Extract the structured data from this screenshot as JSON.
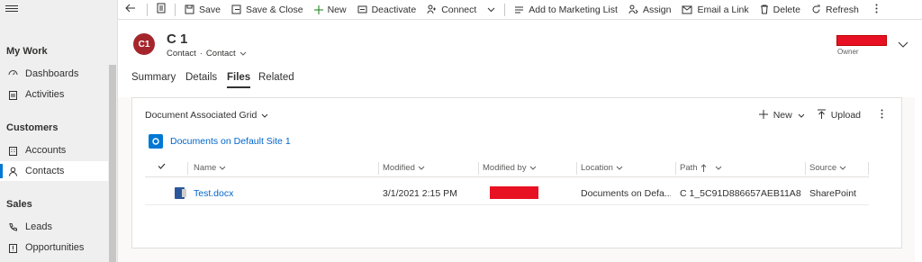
{
  "sidebar": {
    "sections": [
      {
        "label": "My Work"
      },
      {
        "label": "Customers"
      },
      {
        "label": "Sales"
      }
    ],
    "items": [
      {
        "label": "Dashboards",
        "icon": "dashboard-icon"
      },
      {
        "label": "Activities",
        "icon": "clipboard-icon"
      },
      {
        "label": "Accounts",
        "icon": "building-icon"
      },
      {
        "label": "Contacts",
        "icon": "person-icon"
      },
      {
        "label": "Leads",
        "icon": "phone-icon"
      },
      {
        "label": "Opportunities",
        "icon": "book-icon"
      }
    ]
  },
  "commandbar": {
    "save": "Save",
    "save_close": "Save & Close",
    "new": "New",
    "deactivate": "Deactivate",
    "connect": "Connect",
    "add_marketing": "Add to Marketing List",
    "assign": "Assign",
    "email_link": "Email a Link",
    "delete": "Delete",
    "refresh": "Refresh"
  },
  "record": {
    "initials": "C1",
    "title": "C 1",
    "entity": "Contact",
    "form": "Contact",
    "owner_label": "Owner"
  },
  "tabs": [
    {
      "label": "Summary"
    },
    {
      "label": "Details"
    },
    {
      "label": "Files"
    },
    {
      "label": "Related"
    }
  ],
  "grid": {
    "title": "Document Associated Grid",
    "new_label": "New",
    "upload_label": "Upload",
    "site_label": "Documents on Default Site 1",
    "columns": [
      "Name",
      "Modified",
      "Modified by",
      "Location",
      "Path",
      "Source"
    ],
    "rows": [
      {
        "name": "Test.docx",
        "modified": "3/1/2021 2:15 PM",
        "location": "Documents on Defa...",
        "path": "C 1_5C91D886657AEB11A8...",
        "source": "SharePoint"
      }
    ]
  },
  "colors": {
    "accent": "#0078d4",
    "avatar": "#a4262c",
    "redaction": "#e81123"
  }
}
